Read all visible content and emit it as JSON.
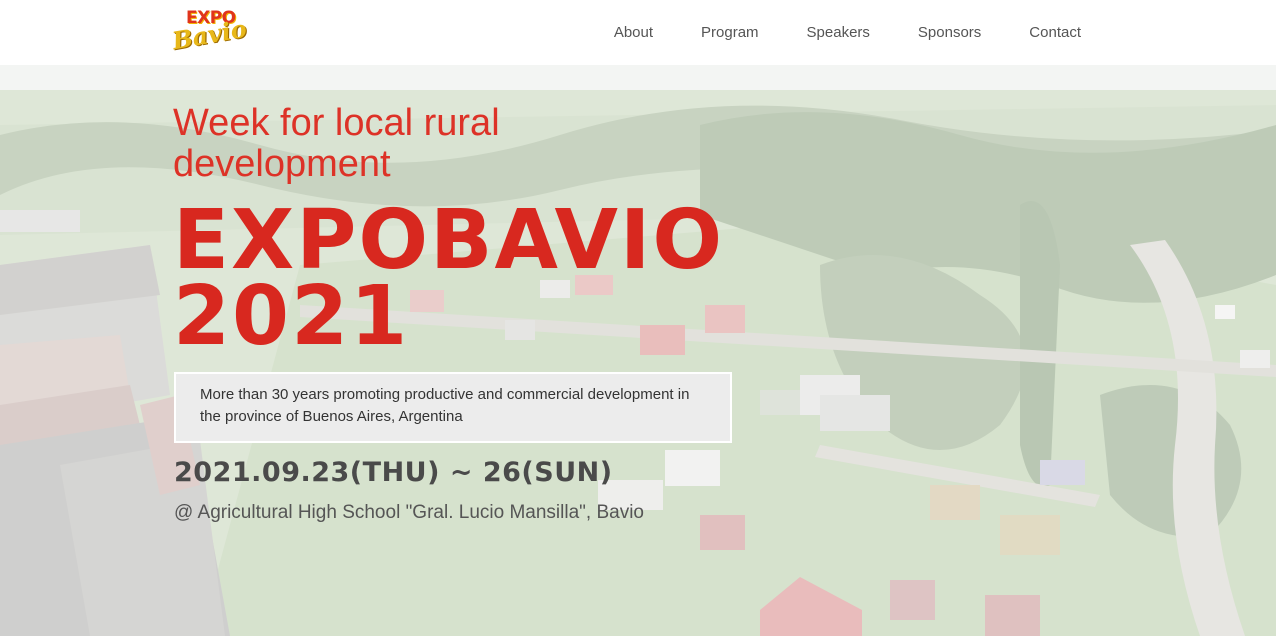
{
  "header": {
    "logo_top": "EXPO",
    "logo_bottom": "Bavio",
    "nav": [
      "About",
      "Program",
      "Speakers",
      "Sponsors",
      "Contact"
    ]
  },
  "hero": {
    "tagline": "Week for local rural development",
    "title_line1": "EXPOBAVIO",
    "title_line2": "2021",
    "description": "More than 30 years promoting productive and commercial development in the province of Buenos Aires, Argentina",
    "dates": "2021.09.23(THU) ~ 26(SUN)",
    "venue": "@ Agricultural High School \"Gral. Lucio Mansilla\", Bavio"
  },
  "colors": {
    "accent_red": "#d8281f",
    "logo_gold": "#e8b81a",
    "nav_text": "#555555"
  }
}
